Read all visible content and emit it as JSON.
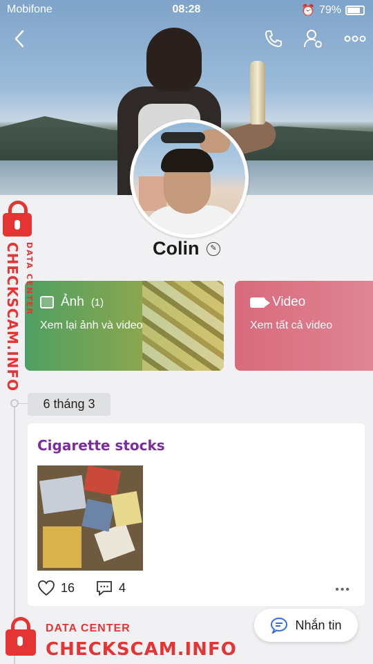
{
  "status_bar": {
    "carrier": "Mobifone",
    "time": "08:28",
    "battery": "79%"
  },
  "top_bar": {
    "back_icon": "chevron-left-icon",
    "call_icon": "phone-icon",
    "settings_icon": "user-settings-icon",
    "more_icon": "more-dots-icon"
  },
  "profile": {
    "name": "Colin"
  },
  "albums": {
    "photos": {
      "title": "Ảnh",
      "count": "(1)",
      "subtitle": "Xem lại ảnh và video"
    },
    "videos": {
      "title": "Video",
      "subtitle": "Xem tất cả video"
    }
  },
  "timeline": {
    "date": "6 tháng 3",
    "post": {
      "title": "Cigarette stocks",
      "likes": "16",
      "comments": "4"
    }
  },
  "message_button": {
    "label": "Nhắn tin"
  },
  "watermark": {
    "top": "DATA CENTER",
    "brand": "CHECKSCAM.INFO"
  },
  "colors": {
    "accent_purple": "#7b2c9e",
    "watermark_red": "#e53434",
    "photo_card_green": "#4f9f63",
    "video_card_pink": "#d86a7d"
  }
}
